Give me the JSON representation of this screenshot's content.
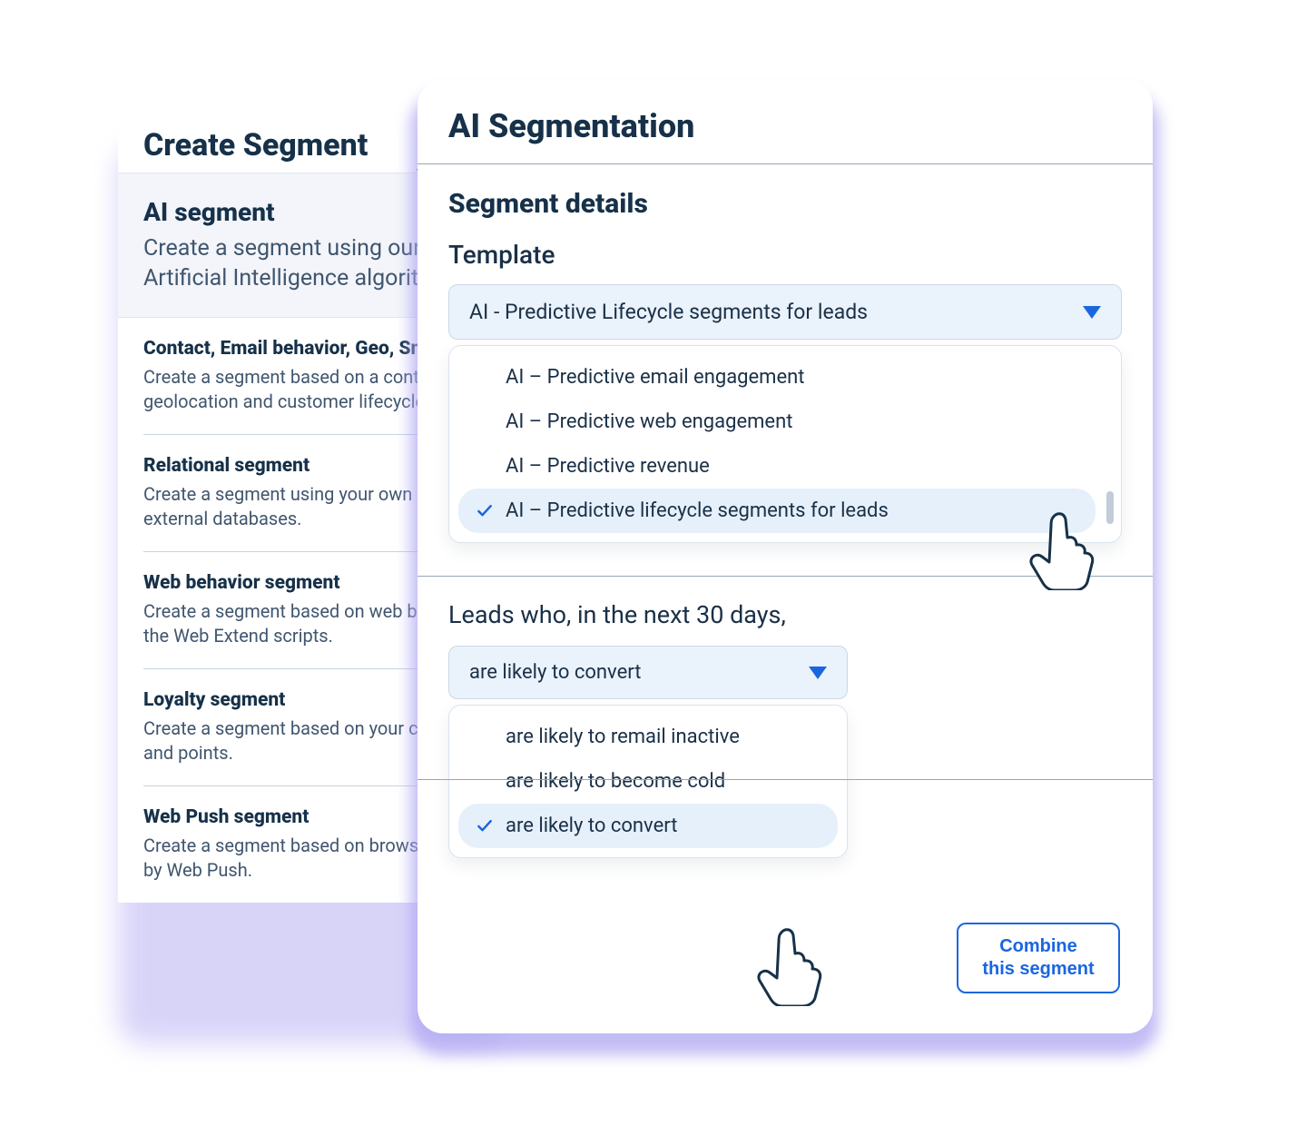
{
  "back": {
    "title": "Create Segment",
    "ai_card": {
      "title": "AI segment",
      "desc": "Create a segment using our Artificial Intelligence algorithms."
    },
    "items": [
      {
        "title": "Contact, Email behavior, Geo, Smart",
        "desc1": "Create a segment based on a contact's",
        "desc2": "geolocation and customer lifecycle data."
      },
      {
        "title": "Relational segment",
        "desc1": "Create a segment using your own business",
        "desc2": "external databases."
      },
      {
        "title": "Web behavior segment",
        "desc1": "Create a segment based on web behavior",
        "desc2": "the Web Extend scripts."
      },
      {
        "title": "Loyalty segment",
        "desc1": "Create a segment based on your contacts'",
        "desc2": "and points."
      },
      {
        "title": "Web Push segment",
        "desc1": "Create a segment based on browser and",
        "desc2": "by Web Push."
      }
    ]
  },
  "front": {
    "title": "AI Segmentation",
    "section": "Segment details",
    "template_label": "Template",
    "template_selected": "AI - Predictive Lifecycle segments for leads",
    "template_options": [
      "AI – Predictive email engagement",
      "AI – Predictive web engagement",
      "AI – Predictive revenue",
      "AI – Predictive lifecycle segments for leads"
    ],
    "template_selected_index": 3,
    "condition_label": "Leads who, in the next 30 days,",
    "condition_selected": "are likely to convert",
    "condition_options": [
      "are likely to remail inactive",
      "are likely to become cold",
      "are likely to convert"
    ],
    "condition_selected_index": 2,
    "combine_line1": "Combine",
    "combine_line2": "this segment"
  }
}
